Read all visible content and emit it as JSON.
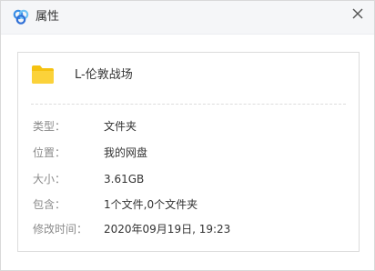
{
  "window": {
    "title": "属性",
    "app_icon": "baidu-netdisk-cloud-icon",
    "close_icon": "close-icon"
  },
  "file": {
    "icon": "folder-icon",
    "name": "L-伦敦战场"
  },
  "properties": [
    {
      "label": "类型：",
      "value": "文件夹"
    },
    {
      "label": "位置：",
      "value": "我的网盘"
    },
    {
      "label": "大小：",
      "value": "3.61GB"
    },
    {
      "label": "包含：",
      "value": "1个文件,0个文件夹"
    },
    {
      "label": "修改时间：",
      "value": "2020年09月19日, 19:23"
    }
  ],
  "colors": {
    "folder": "#f5c211",
    "label": "#8a8a8a",
    "value": "#333333",
    "titlebar": "#f5f6f8"
  }
}
